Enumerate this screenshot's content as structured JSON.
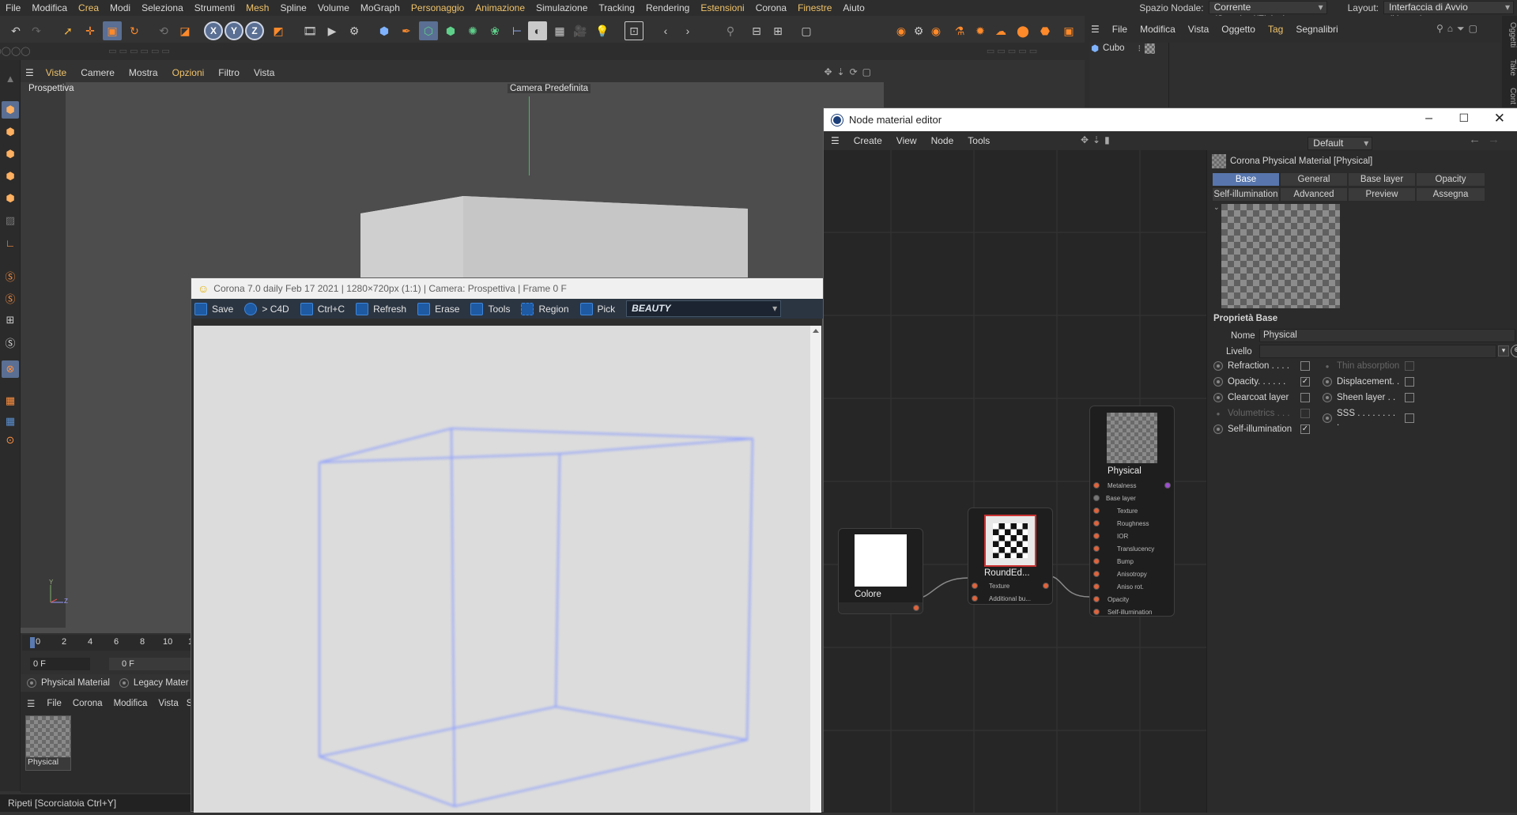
{
  "menubar": {
    "items": [
      "File",
      "Modifica",
      "Crea",
      "Modi",
      "Seleziona",
      "Strumenti",
      "Mesh",
      "Spline",
      "Volume",
      "MoGraph",
      "Personaggio",
      "Animazione",
      "Simulazione",
      "Tracking",
      "Rendering",
      "Estensioni",
      "Corona",
      "Finestre",
      "Aiuto"
    ],
    "highlighted": [
      "Crea",
      "Mesh",
      "Personaggio",
      "Animazione",
      "Estensioni",
      "Finestre"
    ],
    "node_space_label": "Spazio Nodale:",
    "node_space_value": "Corrente (Standard/Fisico)",
    "layout_label": "Layout:",
    "layout_value": "Interfaccia di Avvio (Utente)"
  },
  "viewport": {
    "menu": [
      "Viste",
      "Camere",
      "Mostra",
      "Opzioni",
      "Filtro",
      "Vista"
    ],
    "highlighted": [
      "Viste",
      "Opzioni"
    ],
    "name": "Prospettiva",
    "camera": "Camera Predefinita"
  },
  "timeline": {
    "ticks": [
      "0",
      "2",
      "4",
      "6",
      "8",
      "10",
      "1"
    ],
    "current_frame": "0 F",
    "end_frame": "0 F"
  },
  "material_manager": {
    "tabs": [
      "Physical Material",
      "Legacy Mater"
    ],
    "menu": [
      "File",
      "Corona",
      "Modifica",
      "Vista",
      "S"
    ],
    "material_name": "Physical"
  },
  "status": {
    "text": "Ripeti [Scorciatoia Ctrl+Y]"
  },
  "object_manager": {
    "menu": [
      "File",
      "Modifica",
      "Vista",
      "Oggetto",
      "Tag",
      "Segnalibri"
    ],
    "highlighted": [
      "Tag"
    ],
    "object": "Cubo",
    "side_tabs": [
      "Oggetti",
      "Take",
      "Cont"
    ]
  },
  "corona_vfb": {
    "title": "Corona 7.0 daily Feb 17 2021 | 1280×720px (1:1) | Camera: Prospettiva | Frame 0 F",
    "buttons": [
      "Save",
      "> C4D",
      "Ctrl+C",
      "Refresh",
      "Erase",
      "Tools",
      "Region",
      "Pick"
    ],
    "channel": "BEAUTY"
  },
  "node_editor": {
    "title": "Node material editor",
    "menu": [
      "Create",
      "View",
      "Node",
      "Tools"
    ],
    "preset": "Default",
    "material_header": "Corona Physical Material [Physical]",
    "tabs_row1": [
      "Base",
      "General",
      "Base layer",
      "Opacity"
    ],
    "tabs_row2": [
      "Self-illumination",
      "Advanced",
      "Preview",
      "Assegna"
    ],
    "active_tab": "Base",
    "section": "Proprietà Base",
    "name_label": "Nome",
    "name_value": "Physical",
    "level_label": "Livello",
    "props_left": [
      {
        "label": "Refraction . . . .",
        "checked": false
      },
      {
        "label": "Opacity. . . . . .",
        "checked": true
      },
      {
        "label": "Clearcoat layer",
        "checked": false
      },
      {
        "label": "Volumetrics . . .",
        "checked": false,
        "disabled": true
      },
      {
        "label": "Self-illumination",
        "checked": true
      }
    ],
    "props_right": [
      {
        "label": "Thin absorption",
        "checked": false,
        "disabled": true
      },
      {
        "label": "Displacement. .",
        "checked": false
      },
      {
        "label": "Sheen layer . .",
        "checked": false
      },
      {
        "label": "SSS . . . . . . . . .",
        "checked": false
      }
    ],
    "nodes": {
      "color": {
        "title": "Colore"
      },
      "rounded": {
        "title": "RoundEd...",
        "ports": [
          "Texture",
          "Additional bu..."
        ]
      },
      "physical": {
        "title": "Physical",
        "ports": [
          "Metalness",
          "Base layer",
          "Texture",
          "Roughness",
          "IOR",
          "Translucency",
          "Bump",
          "Anisotropy",
          "Aniso rot.",
          "Opacity",
          "Self-illumination"
        ]
      }
    }
  },
  "colors": {
    "accent": "#5876ad",
    "port": "#e1633b",
    "highlight": "#f0c36a",
    "wire": "#8a9cff"
  }
}
